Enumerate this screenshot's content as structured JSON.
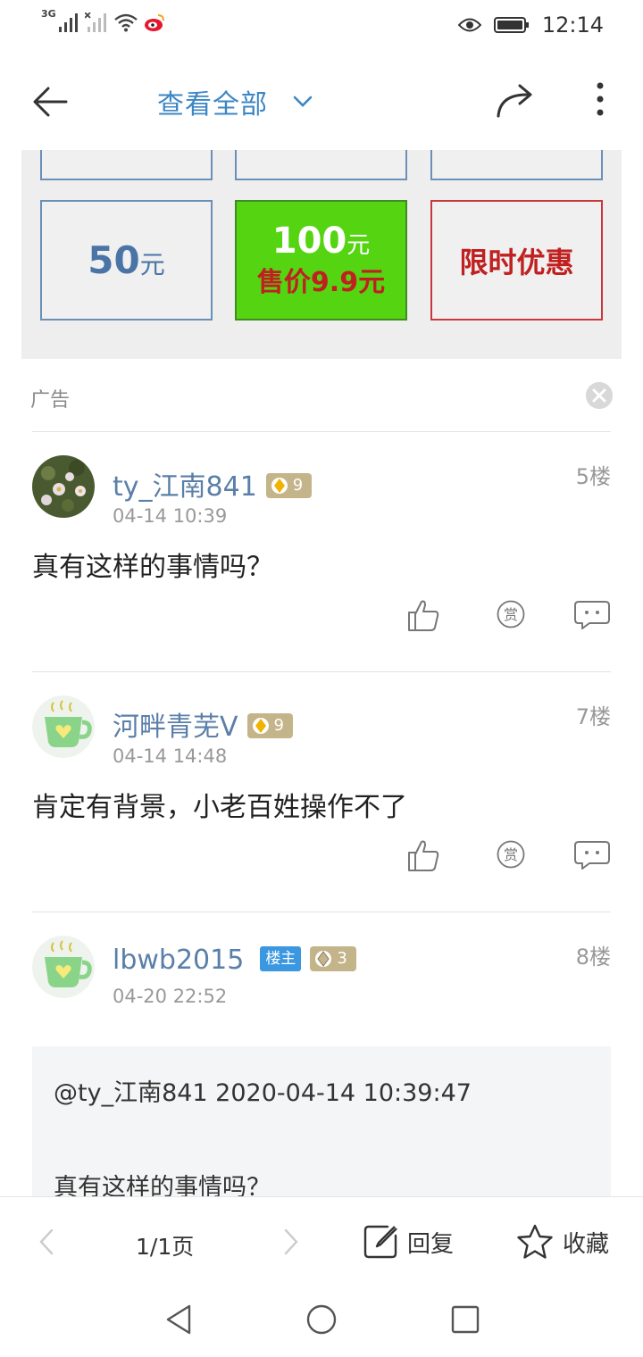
{
  "status_bar": {
    "network_label": "3G",
    "time": "12:14",
    "icons": [
      "signal-icon",
      "signal-off-icon",
      "wifi-icon",
      "weibo-icon",
      "eye-icon",
      "battery-icon"
    ]
  },
  "header": {
    "title": "查看全部",
    "icons": [
      "back-arrow-icon",
      "chevron-down-icon",
      "share-icon",
      "more-vertical-icon"
    ]
  },
  "ad": {
    "tile_50_amount": "50",
    "tile_50_unit": "元",
    "tile_100_amount": "100",
    "tile_100_unit": "元",
    "tile_100_price": "售价9.9元",
    "tile_promo": "限时优惠",
    "label": "广告",
    "colors": {
      "green_tile": "#55d412",
      "price_red": "#c02020",
      "tile_border": "#6a8fb8"
    }
  },
  "posts": [
    {
      "username": "ty_江南841",
      "level": "9",
      "time": "04-14 10:39",
      "floor": "5楼",
      "content": "真有这样的事情吗？"
    },
    {
      "username": "河畔青芜V",
      "level": "9",
      "time": "04-14 14:48",
      "floor": "7楼",
      "content": "肯定有背景，小老百姓操作不了"
    },
    {
      "username": "lbwb2015",
      "op_label": "楼主",
      "level": "3",
      "time": "04-20 22:52",
      "floor": "8楼",
      "quote_head": "@ty_江南841 2020-04-14 10:39:47",
      "quote_body": "真有这样的事情吗？"
    }
  ],
  "actions": {
    "reward_label": "赏"
  },
  "bottom_bar": {
    "page_text": "1/1页",
    "reply_label": "回复",
    "favorite_label": "收藏"
  },
  "theme": {
    "accent": "#3b86c4",
    "username": "#5a7fa8",
    "level_badge": "#c4b48a",
    "op_badge": "#3a97e0"
  }
}
